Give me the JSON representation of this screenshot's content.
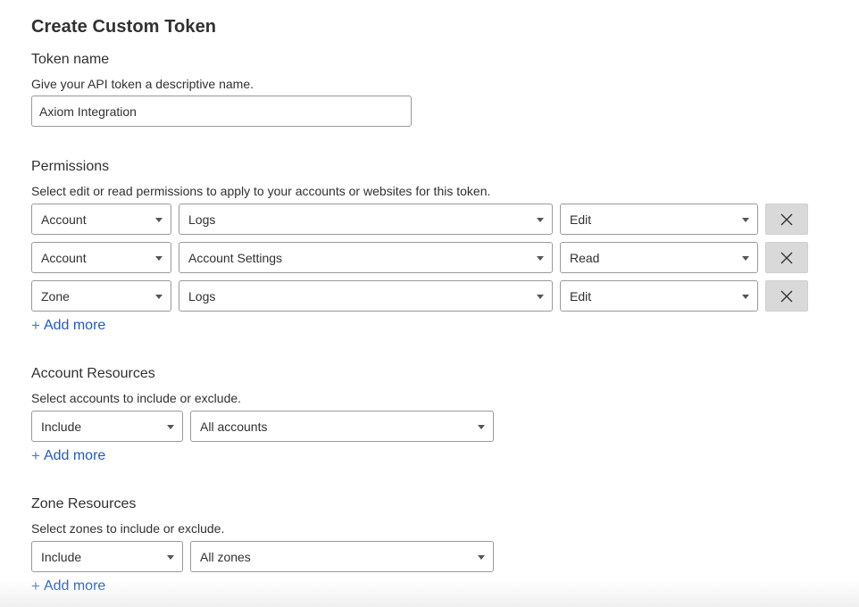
{
  "page": {
    "title": "Create Custom Token"
  },
  "token_name": {
    "label": "Token name",
    "description": "Give your API token a descriptive name.",
    "value": "Axiom Integration"
  },
  "permissions": {
    "label": "Permissions",
    "description": "Select edit or read permissions to apply to your accounts or websites for this token.",
    "rows": [
      {
        "scope": "Account",
        "item": "Logs",
        "level": "Edit"
      },
      {
        "scope": "Account",
        "item": "Account Settings",
        "level": "Read"
      },
      {
        "scope": "Zone",
        "item": "Logs",
        "level": "Edit"
      }
    ],
    "add_more": "Add more"
  },
  "account_resources": {
    "label": "Account Resources",
    "description": "Select accounts to include or exclude.",
    "mode": "Include",
    "target": "All accounts",
    "add_more": "Add more"
  },
  "zone_resources": {
    "label": "Zone Resources",
    "description": "Select zones to include or exclude.",
    "mode": "Include",
    "target": "All zones",
    "add_more": "Add more"
  },
  "icons": {
    "remove": "close-icon",
    "add": "plus-icon",
    "dropdown": "chevron-down-icon"
  },
  "colors": {
    "link": "#1f5bbf",
    "border": "#9a9a9a",
    "remove_button_bg": "#d9d9d9"
  }
}
